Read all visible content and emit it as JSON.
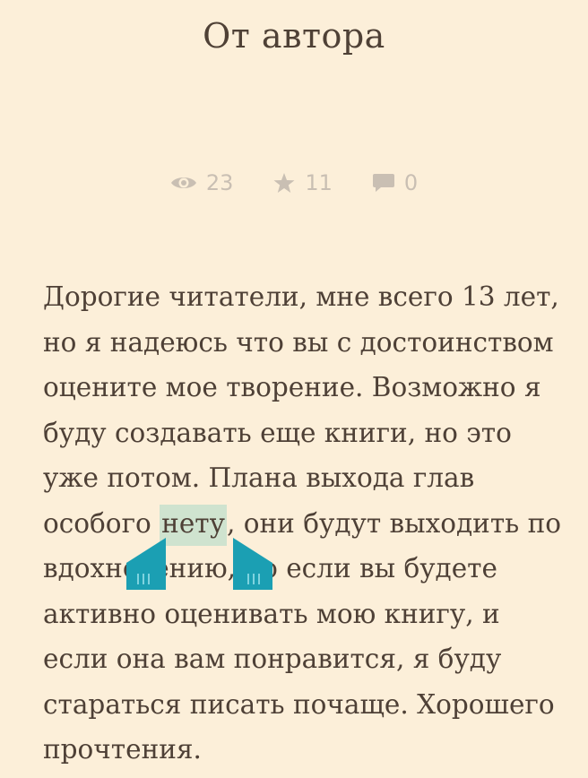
{
  "header": {
    "title": "От автора"
  },
  "stats": {
    "views": "23",
    "stars": "11",
    "comments": "0"
  },
  "content": {
    "lines": {
      "l1": "Дорогие читатели, мне всего 13 лет,",
      "l2": "но я надеюсь что вы с достоинством",
      "l3": "оцените мое творение. Возможно я",
      "l4": "буду создавать еще книги, но это",
      "l5": "уже потом. Плана выхода глав",
      "l6_before": "особого ",
      "l6_selected": "нету",
      "l6_after": ", они будут выходить по",
      "l7": "вдохновению, но если вы будете",
      "l8": "активно оценивать мою книгу, и",
      "l9": "если она вам понравится, я буду",
      "l10": "стараться писать почаще. Хорошего",
      "l11": "прочтения."
    }
  },
  "colors": {
    "background": "#fcefd9",
    "text": "#4e4036",
    "selection": "#cfe3cf",
    "handle": "#1b9fb3",
    "stats": "#c9bfb3"
  },
  "icons": {
    "views": "eye-icon",
    "stars": "star-icon",
    "comments": "comment-icon",
    "handles": "selection-handle-icon"
  }
}
